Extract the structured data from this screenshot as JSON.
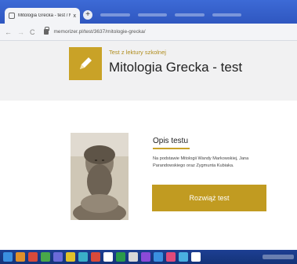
{
  "browser": {
    "tab_title": "Mitologia Grecka - test / Memo",
    "tab_close_glyph": "x",
    "new_tab_glyph": "+",
    "back_glyph": "←",
    "forward_glyph": "→",
    "reload_glyph": "C",
    "url": "memorizer.pl/test/3637/mitologie-grecka/"
  },
  "header": {
    "subtitle": "Test z lektury szkolnej",
    "title": "Mitologia Grecka - test",
    "icon": "pencil-icon"
  },
  "content": {
    "section_title": "Opis testu",
    "description": "Na podstawie Mitologii Wandy Markowskiej, Jana Parandowskiego oraz Zygmunta Kubiaka.",
    "cta_label": "Rozwiąż test",
    "image": "zeus-bust-image"
  },
  "colors": {
    "accent": "#c19b21",
    "accent_text": "#b08d1e",
    "desktop": "#2f5bc4"
  },
  "taskbar": {
    "icons": [
      "#3a8fe0",
      "#e0902a",
      "#d84a3a",
      "#49a84a",
      "#6a6ad8",
      "#e0c22a",
      "#3ab0c8",
      "#d84a3a",
      "#ffffff",
      "#2a9a4a",
      "#d8d8d8",
      "#8a4ad8",
      "#3a8fe0",
      "#e04a7a",
      "#4ab0e0",
      "#ffffff"
    ]
  }
}
